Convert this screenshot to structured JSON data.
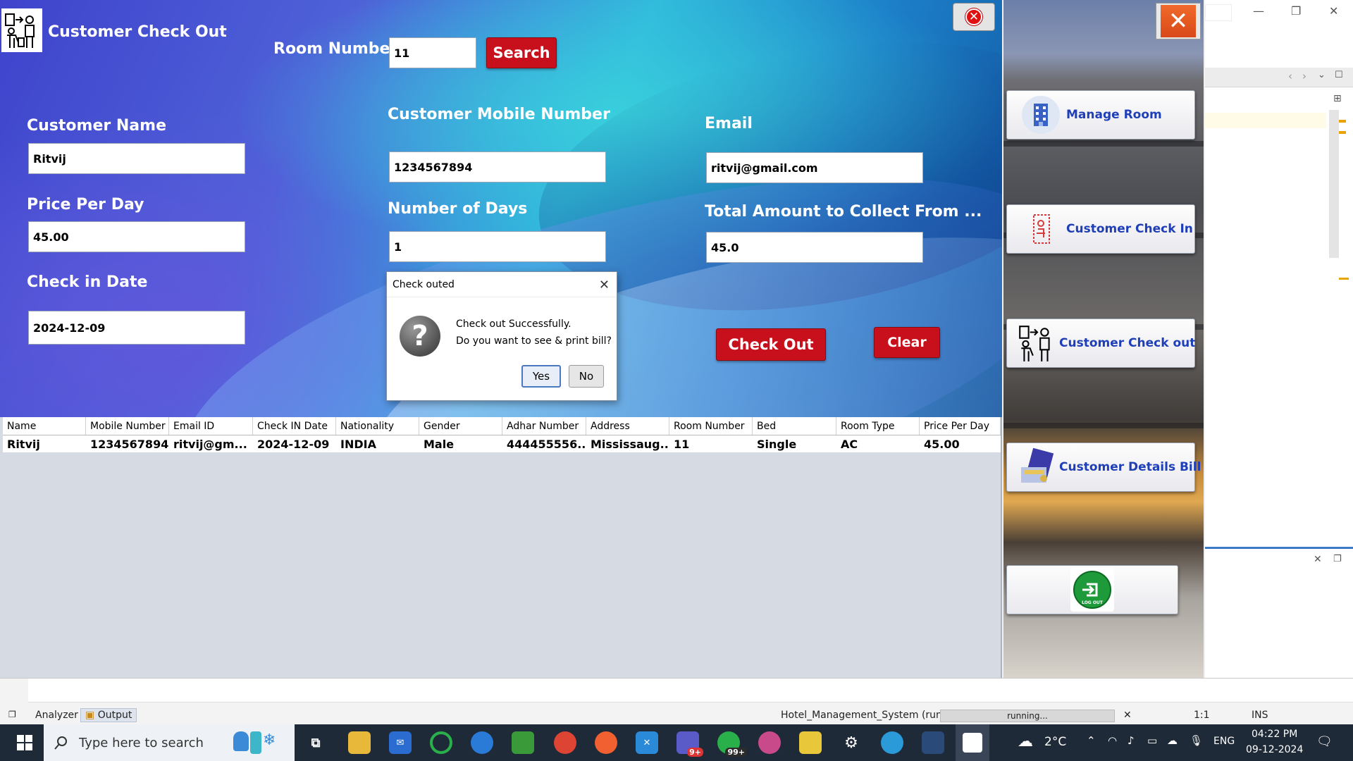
{
  "window": {
    "title": "Customer Check Out"
  },
  "search": {
    "room_label": "Room Number",
    "room_value": "11",
    "search_label": "Search"
  },
  "form": {
    "customer_name": {
      "label": "Customer Name",
      "value": "Ritvij"
    },
    "mobile": {
      "label": "Customer Mobile Number",
      "value": "1234567894"
    },
    "email": {
      "label": "Email",
      "value": "ritvij@gmail.com"
    },
    "price_per_day": {
      "label": "Price Per Day",
      "value": "45.00"
    },
    "number_of_days": {
      "label": "Number of Days",
      "value": "1"
    },
    "total_amount": {
      "label": "Total Amount to Collect From ...",
      "value": "45.0"
    },
    "check_in_date": {
      "label": "Check in Date",
      "value": "2024-12-09"
    }
  },
  "actions": {
    "check_out": "Check Out",
    "clear": "Clear"
  },
  "table": {
    "headers": [
      "Name",
      "Mobile Number",
      "Email ID",
      "Check IN Date",
      "Nationality",
      "Gender",
      "Adhar Number",
      "Address",
      "Room Number",
      "Bed",
      "Room Type",
      "Price Per Day"
    ],
    "rows": [
      [
        "Ritvij",
        "1234567894",
        "ritvij@gm...",
        "2024-12-09",
        "INDIA",
        "Male",
        "444455556...",
        "Mississaug...",
        "11",
        "Single",
        "AC",
        "45.00"
      ]
    ]
  },
  "dialog": {
    "title": "Check outed",
    "line1": "Check out Successfully.",
    "line2": "Do you want to see & print bill?",
    "yes": "Yes",
    "no": "No"
  },
  "menu": {
    "items": [
      {
        "label": "Manage Room",
        "icon": "building-icon"
      },
      {
        "label": "Customer Check In",
        "icon": "check-in-icon"
      },
      {
        "label": "Customer Check out",
        "icon": "check-out-icon"
      },
      {
        "label": "Customer Details Bill",
        "icon": "bill-icon"
      },
      {
        "label": "",
        "icon": "logout-icon",
        "logout_text": "LOG OUT"
      }
    ]
  },
  "ide": {
    "tabs": {
      "analyzer": "Analyzer",
      "output": "Output"
    },
    "run_status": "Hotel_Management_System (run)",
    "progress_text": "running...",
    "position": "1:1",
    "mode": "INS"
  },
  "taskbar": {
    "search_placeholder": "Type here to search",
    "weather": "2°C",
    "language": "ENG",
    "time": "04:22 PM",
    "date": "09-12-2024",
    "teams_badge": "9+",
    "whatsapp_badge": "99+"
  },
  "colors": {
    "accent_red": "#c8101c",
    "menu_text": "#1f3fb8",
    "taskbar": "#1f2a38"
  }
}
